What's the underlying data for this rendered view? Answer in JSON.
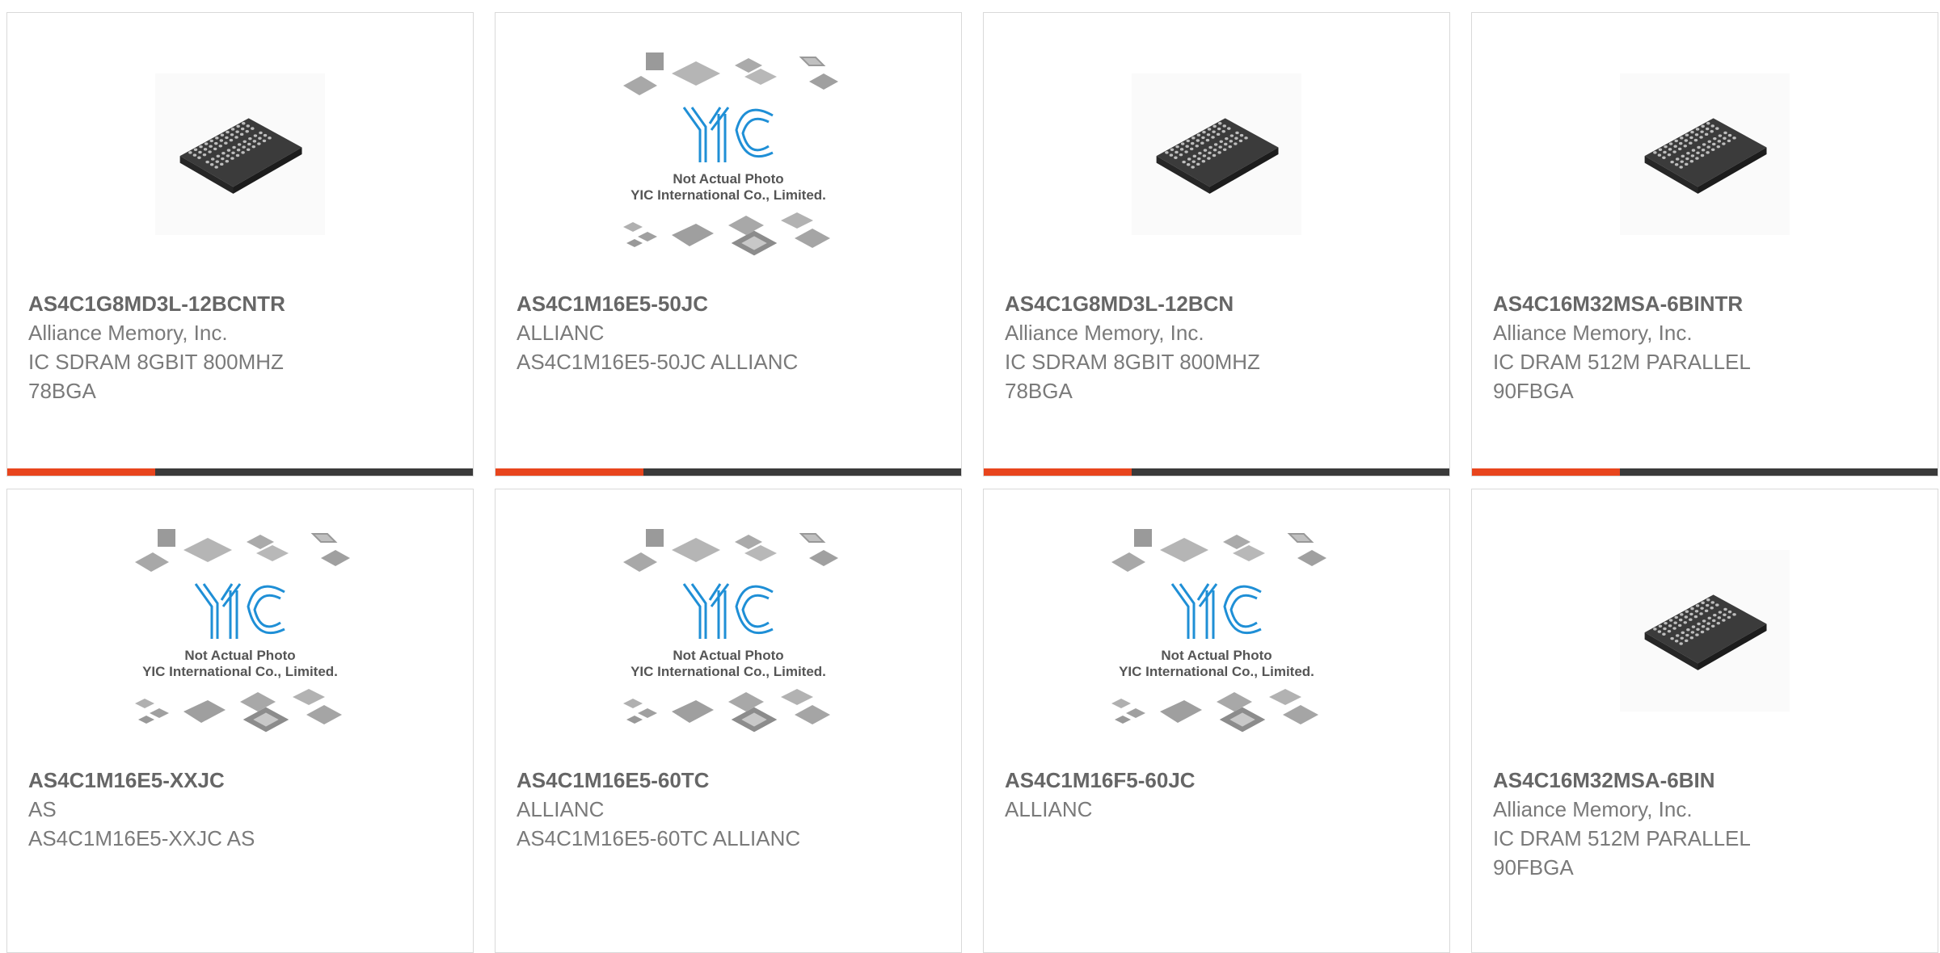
{
  "colors": {
    "accent": "#e8451d",
    "bar": "#3a3a3a",
    "title": "#666666",
    "text": "#7a7a7a",
    "logo": "#1f8fd6"
  },
  "placeholder": {
    "caption_line1": "Not Actual Photo",
    "caption_line2": "YIC International Co., Limited.",
    "logo_text": "YIC"
  },
  "products": [
    {
      "part": "AS4C1G8MD3L-12BCNTR",
      "manufacturer": "Alliance Memory, Inc.",
      "description": "IC SDRAM 8GBIT 800MHZ 78BGA",
      "image": "bga-chip-photo"
    },
    {
      "part": "AS4C1M16E5-50JC",
      "manufacturer": "ALLIANC",
      "description": "AS4C1M16E5-50JC ALLIANC",
      "image": "placeholder-not-actual-photo"
    },
    {
      "part": "AS4C1G8MD3L-12BCN",
      "manufacturer": "Alliance Memory, Inc.",
      "description": "IC SDRAM 8GBIT 800MHZ 78BGA",
      "image": "bga-chip-photo"
    },
    {
      "part": "AS4C16M32MSA-6BINTR",
      "manufacturer": "Alliance Memory, Inc.",
      "description": "IC DRAM 512M PARALLEL 90FBGA",
      "image": "bga-chip-photo"
    },
    {
      "part": "AS4C1M16E5-XXJC",
      "manufacturer": "AS",
      "description": "AS4C1M16E5-XXJC AS",
      "image": "placeholder-not-actual-photo"
    },
    {
      "part": "AS4C1M16E5-60TC",
      "manufacturer": "ALLIANC",
      "description": "AS4C1M16E5-60TC ALLIANC",
      "image": "placeholder-not-actual-photo"
    },
    {
      "part": "AS4C1M16F5-60JC",
      "manufacturer": "ALLIANC",
      "description": "",
      "image": "placeholder-not-actual-photo"
    },
    {
      "part": "AS4C16M32MSA-6BIN",
      "manufacturer": "Alliance Memory, Inc.",
      "description": "IC DRAM 512M PARALLEL 90FBGA",
      "image": "bga-chip-photo"
    }
  ]
}
